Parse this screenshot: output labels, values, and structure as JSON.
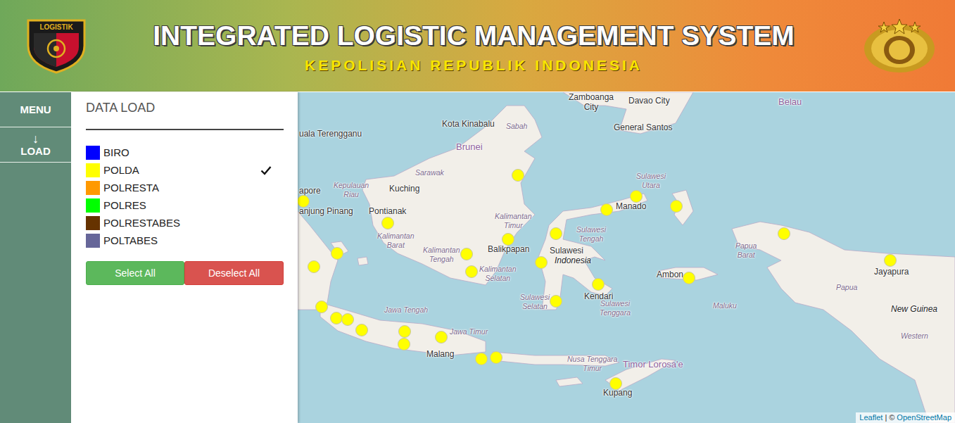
{
  "header": {
    "logo_text": "LOGISTIK",
    "title": "INTEGRATED LOGISTIC MANAGEMENT SYSTEM",
    "subtitle": "KEPOLISIAN REPUBLIK INDONESIA"
  },
  "nav": [
    {
      "label": "MENU"
    },
    {
      "label": "LOAD",
      "icon": "↓"
    }
  ],
  "panel": {
    "title": "DATA LOAD",
    "layers": [
      {
        "label": "BIRO",
        "color": "#0000ff",
        "checked": false
      },
      {
        "label": "POLDA",
        "color": "#ffff00",
        "checked": true
      },
      {
        "label": "POLRESTA",
        "color": "#ff9900",
        "checked": false
      },
      {
        "label": "POLRES",
        "color": "#00ff00",
        "checked": false
      },
      {
        "label": "POLRESTABES",
        "color": "#663300",
        "checked": false
      },
      {
        "label": "POLTABES",
        "color": "#666699",
        "checked": false
      }
    ],
    "buttons": [
      {
        "label": "Select All",
        "kind": "select"
      },
      {
        "label": "Deselect All",
        "kind": "deselect"
      }
    ]
  },
  "map": {
    "labels": [
      {
        "lines": [
          "Zamboanga",
          "City"
        ],
        "kind": "city"
      },
      {
        "lines": [
          "Davao City"
        ],
        "kind": "city"
      },
      {
        "lines": [
          "Belau"
        ],
        "kind": "country"
      },
      {
        "lines": [
          "Kota Kinabalu"
        ],
        "kind": "city"
      },
      {
        "lines": [
          "Sabah"
        ],
        "kind": "region"
      },
      {
        "lines": [
          "General Santos"
        ],
        "kind": "city"
      },
      {
        "lines": [
          "Brunei"
        ],
        "kind": "country"
      },
      {
        "lines": [
          "uala Terengganu"
        ],
        "kind": "city"
      },
      {
        "lines": [
          "Sarawak"
        ],
        "kind": "region"
      },
      {
        "lines": [
          "Kuching"
        ],
        "kind": "city"
      },
      {
        "lines": [
          "Kepulauan",
          "Riau"
        ],
        "kind": "region"
      },
      {
        "lines": [
          "Sulawesi",
          "Utara"
        ],
        "kind": "region"
      },
      {
        "lines": [
          "Manado"
        ],
        "kind": "city"
      },
      {
        "lines": [
          "Pontianak"
        ],
        "kind": "city"
      },
      {
        "lines": [
          "Kalimantan",
          "Barat"
        ],
        "kind": "region"
      },
      {
        "lines": [
          "Kalimantan",
          "Timur"
        ],
        "kind": "region"
      },
      {
        "lines": [
          "Sulawesi",
          "Tengah"
        ],
        "kind": "region"
      },
      {
        "lines": [
          "Papua",
          "Barat"
        ],
        "kind": "region"
      },
      {
        "lines": [
          "Balikpapan"
        ],
        "kind": "city"
      },
      {
        "lines": [
          "Sulawesi"
        ],
        "kind": "city"
      },
      {
        "lines": [
          "Indonesia"
        ],
        "kind": "island"
      },
      {
        "lines": [
          "Kalimantan",
          "Tengah"
        ],
        "kind": "region"
      },
      {
        "lines": [
          "Kalimantan",
          "Selatan"
        ],
        "kind": "region"
      },
      {
        "lines": [
          "Jayapura"
        ],
        "kind": "city"
      },
      {
        "lines": [
          "Ambon"
        ],
        "kind": "city"
      },
      {
        "lines": [
          "Kendari"
        ],
        "kind": "city"
      },
      {
        "lines": [
          "Papua"
        ],
        "kind": "region"
      },
      {
        "lines": [
          "Sulawesi",
          "Tenggara"
        ],
        "kind": "region"
      },
      {
        "lines": [
          "Sulawesi",
          "Selatan"
        ],
        "kind": "region"
      },
      {
        "lines": [
          "Maluku"
        ],
        "kind": "region"
      },
      {
        "lines": [
          "New Guinea"
        ],
        "kind": "island"
      },
      {
        "lines": [
          "Jawa Tengah"
        ],
        "kind": "region"
      },
      {
        "lines": [
          "Western"
        ],
        "kind": "region"
      },
      {
        "lines": [
          "Jawa Timur"
        ],
        "kind": "region"
      },
      {
        "lines": [
          "Malang"
        ],
        "kind": "city"
      },
      {
        "lines": [
          "Nusa Tenggara",
          "Timur"
        ],
        "kind": "region"
      },
      {
        "lines": [
          "Timor Lorosa'e"
        ],
        "kind": "country"
      },
      {
        "lines": [
          "Kupang"
        ],
        "kind": "city"
      },
      {
        "lines": [
          "apore"
        ],
        "kind": "city"
      },
      {
        "lines": [
          "anjung Pinang"
        ],
        "kind": "city"
      }
    ],
    "attribution": {
      "link1": "Leaflet",
      "separator": "|",
      "copyright": "©",
      "link2": "OpenStreetMap"
    }
  }
}
